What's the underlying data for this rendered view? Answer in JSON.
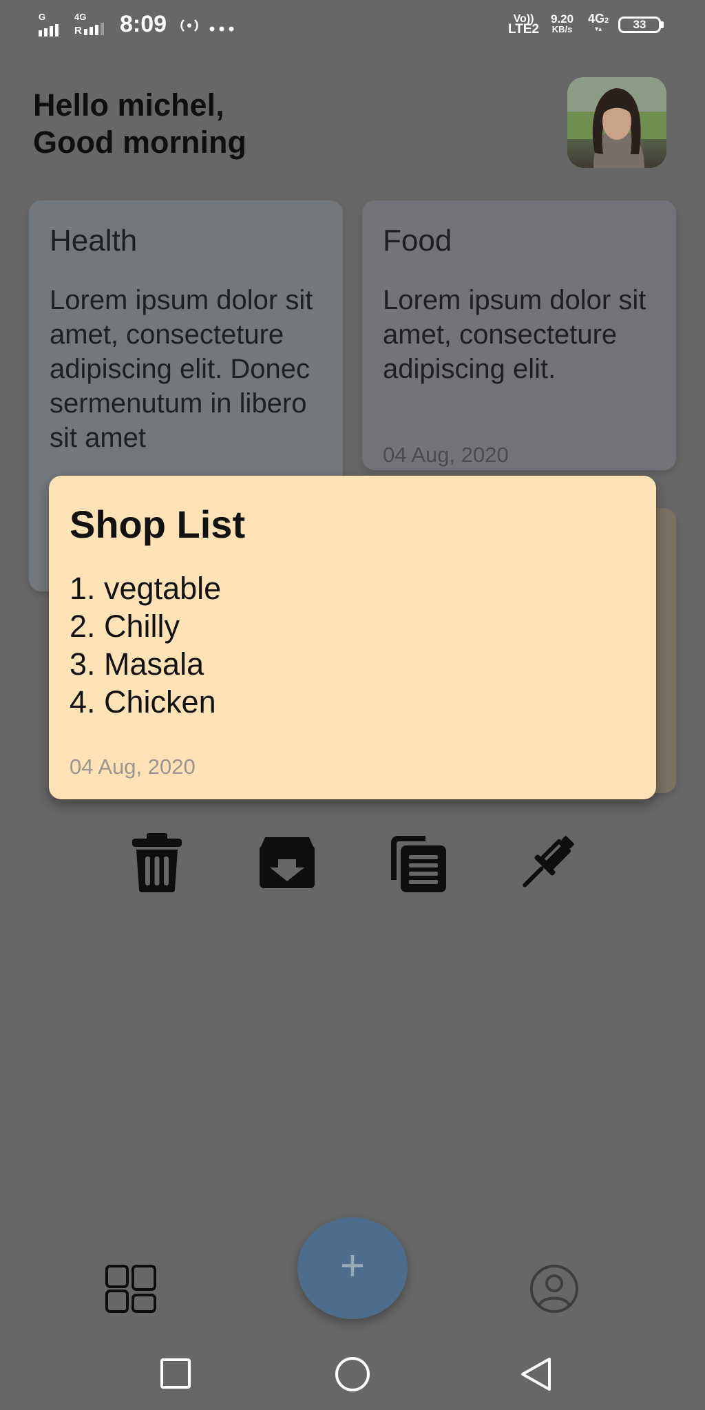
{
  "status_bar": {
    "network_1": "G",
    "network_2": "4G",
    "network_2_sub": "R",
    "time": "8:09",
    "volte_top": "Vo))",
    "volte_bottom": "LTE2",
    "speed_value": "9.20",
    "speed_unit": "KB/s",
    "network_3": "4G",
    "network_3_sub": "2",
    "battery": "33"
  },
  "greeting": {
    "line1": "Hello michel,",
    "line2": "Good morning"
  },
  "notes": {
    "health": {
      "title": "Health",
      "body": "Lorem ipsum dolor sit amet, consecteture adipiscing elit. Donec sermenutum in libero sit amet"
    },
    "food": {
      "title": "Food",
      "body": "Lorem ipsum dolor sit amet, consecteture adipiscing elit.",
      "date": "04 Aug, 2020"
    }
  },
  "popup": {
    "title": "Shop List",
    "items": [
      "1. vegtable",
      "2. Chilly",
      "3. Masala",
      "4. Chicken"
    ],
    "date": "04 Aug, 2020"
  },
  "actions": [
    "trash-icon",
    "archive-icon",
    "copy-icon",
    "pin-icon"
  ],
  "bottom_nav": {
    "fab_label": "+",
    "icons": [
      "dashboard-icon",
      "profile-icon"
    ]
  },
  "colors": {
    "scrim": "#676767",
    "popup": "#ffe2b5",
    "fab": "#4e6d8c",
    "health_card": "#73787c",
    "food_card": "#747379"
  }
}
